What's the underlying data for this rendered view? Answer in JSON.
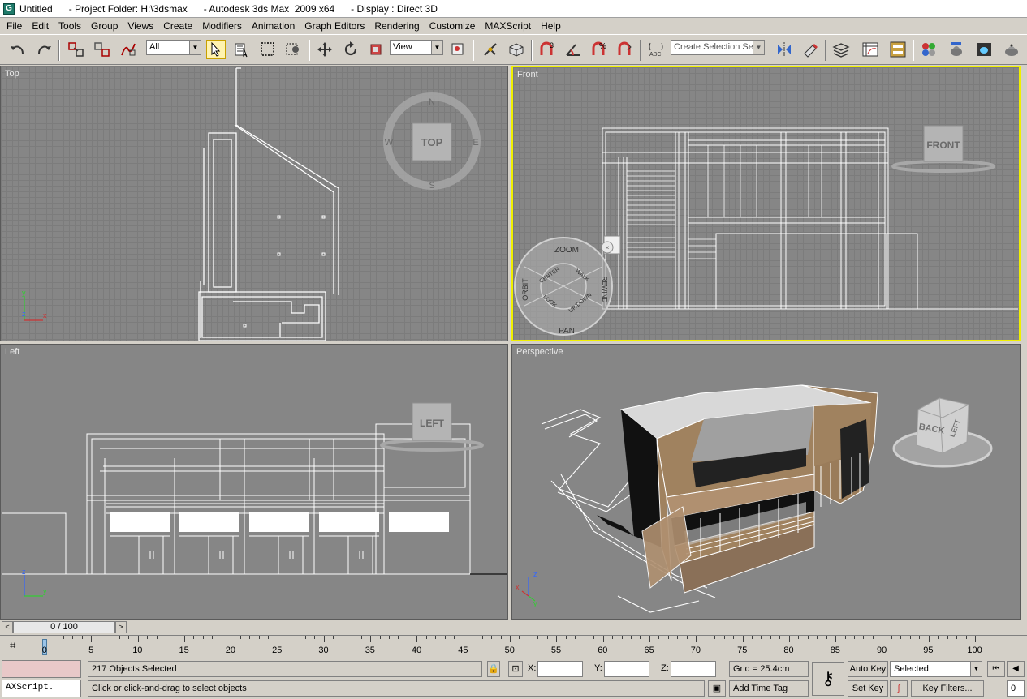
{
  "titlebar": {
    "title": "Untitled      - Project Folder: H:\\3dsmax      - Autodesk 3ds Max  2009 x64      - Display : Direct 3D"
  },
  "menu": [
    "File",
    "Edit",
    "Tools",
    "Group",
    "Views",
    "Create",
    "Modifiers",
    "Animation",
    "Graph Editors",
    "Rendering",
    "Customize",
    "MAXScript",
    "Help"
  ],
  "toolbar": {
    "selection_filter": "All",
    "reference_coord": "View",
    "selection_set_placeholder": "Create Selection Set",
    "snap_labels": [
      "3",
      "%"
    ]
  },
  "viewports": {
    "top": {
      "label": "Top",
      "cube_label": "TOP",
      "compass": [
        "N",
        "S",
        "E",
        "W"
      ]
    },
    "front": {
      "label": "Front",
      "cube_label": "FRONT"
    },
    "left": {
      "label": "Left",
      "cube_label": "LEFT"
    },
    "perspective": {
      "label": "Perspective",
      "cube_labels": [
        "BACK",
        "LEFT"
      ]
    }
  },
  "steering_wheel": {
    "labels": [
      "ZOOM",
      "ORBIT",
      "PAN",
      "REWIND",
      "CENTER",
      "WALK",
      "LOOK",
      "UP/DOWN"
    ]
  },
  "timeline": {
    "frame_display": "0 / 100",
    "ruler_labels": [
      "0",
      "5",
      "10",
      "15",
      "20",
      "25",
      "30",
      "35",
      "40",
      "45",
      "50",
      "55",
      "60",
      "65",
      "70",
      "75",
      "80",
      "85",
      "90",
      "95",
      "100"
    ]
  },
  "status": {
    "maxscript_label": "AXScript.",
    "selection_info": "217 Objects Selected",
    "prompt": "Click or click-and-drag to select objects",
    "x_label": "X:",
    "y_label": "Y:",
    "z_label": "Z:",
    "grid": "Grid = 25.4cm",
    "add_time_tag": "Add Time Tag",
    "auto_key": "Auto Key",
    "set_key": "Set Key",
    "key_mode": "Selected",
    "key_filters": "Key Filters...",
    "frame_value": "0"
  },
  "axes": {
    "x": "x",
    "y": "y",
    "z": "z"
  },
  "colors": {
    "viewport_bg": "#868686",
    "active_border": "#f0f000",
    "building_brown": "#a0825f"
  }
}
